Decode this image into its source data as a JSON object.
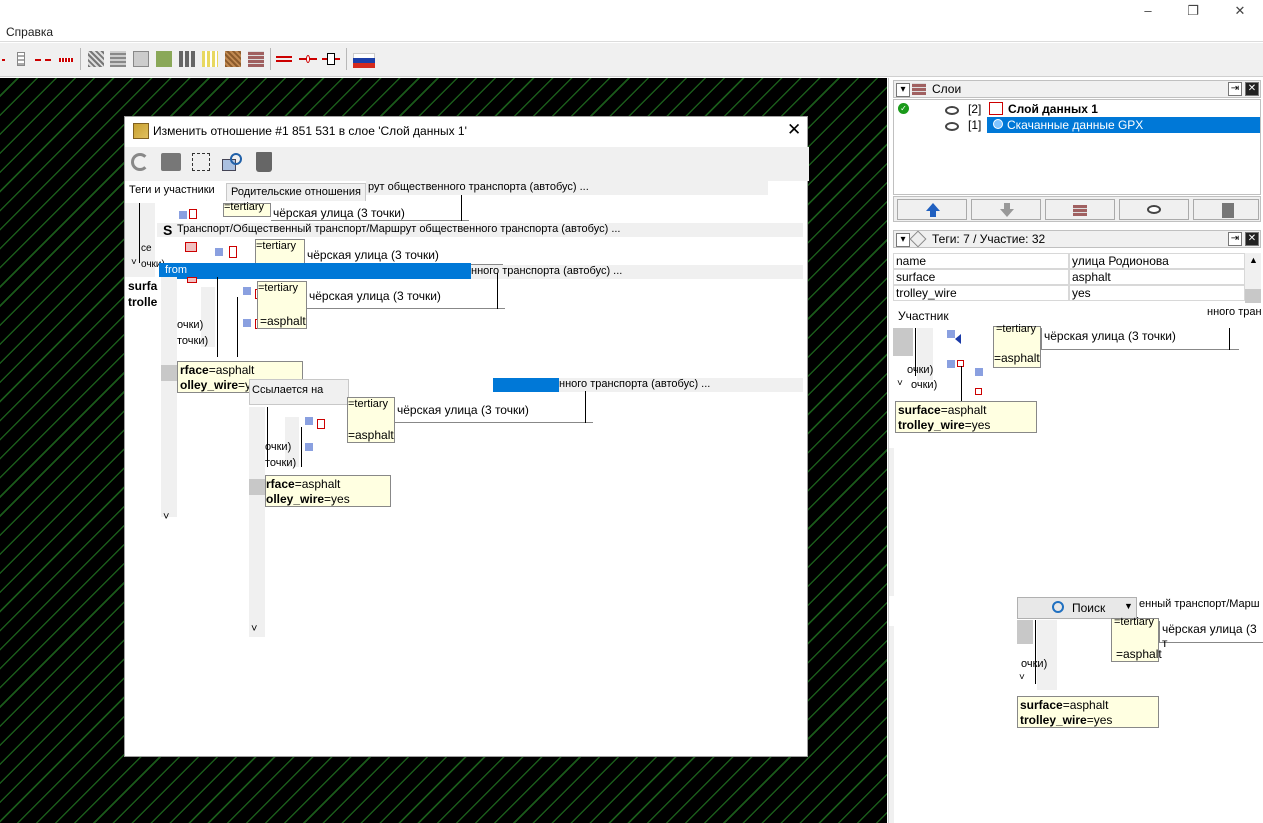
{
  "window": {
    "controls": [
      "–",
      "❐",
      "✕"
    ]
  },
  "menu": {
    "help": "Справка"
  },
  "colors": {
    "accent": "#0078d7",
    "tooltip": "#ffffe1",
    "panel_header": "#f0f0f0",
    "map_bg": "#000000",
    "map_stripe": "#1a5a1a"
  },
  "dialog": {
    "title": "Изменить отношение #1 851 531 в слое 'Слой данных 1'",
    "close": "✕",
    "tabs": {
      "tags_members": "Теги и участники",
      "parent_relations": "Родительские отношения"
    },
    "fragments": {
      "route_bus_short": "рут общественного транспорта (автобус) ...",
      "route_full": "Транспорт/Общественный транспорт/Маршрут общественного транспорта (автобус) ...",
      "route_tail": "нного транспорта (автобус) ...",
      "street_3pts": "чёрская улица (3 точки)",
      "tertiary": "=tertiary",
      "asphalt": "=asphalt",
      "surface_key": "surface",
      "surface_val": "=asphalt",
      "trolley_key": "trolley_wire",
      "trolley_val": "=yes",
      "surface_trunc": "surfa",
      "trolley_trunc": "trolle",
      "tochki": "точки)",
      "tochki2": "очки)",
      "from": "from",
      "refers_to": "Ссылается на",
      "chevron_down": "˅",
      "rface": "rface",
      "olley_wire": "olley_wire",
      "ce": "ce"
    }
  },
  "layers_panel": {
    "title": "Слои",
    "layers": [
      {
        "index": "[2]",
        "name": "Слой данных 1",
        "active": true
      },
      {
        "index": "[1]",
        "name": "Скачанные данные GPX",
        "active": false
      }
    ]
  },
  "tags_panel": {
    "title": "Теги: 7 / Участие: 32",
    "rows": [
      {
        "key": "name",
        "value": "улица Родионова"
      },
      {
        "key": "surface",
        "value": "asphalt"
      },
      {
        "key": "trolley_wire",
        "value": "yes"
      }
    ],
    "member_header": "Участник",
    "member_tail": "нного тран"
  },
  "search": {
    "label": "Поиск",
    "route_tail": "енный транспорт/Марш",
    "street_3pts": "чёрская улица (3 т"
  }
}
